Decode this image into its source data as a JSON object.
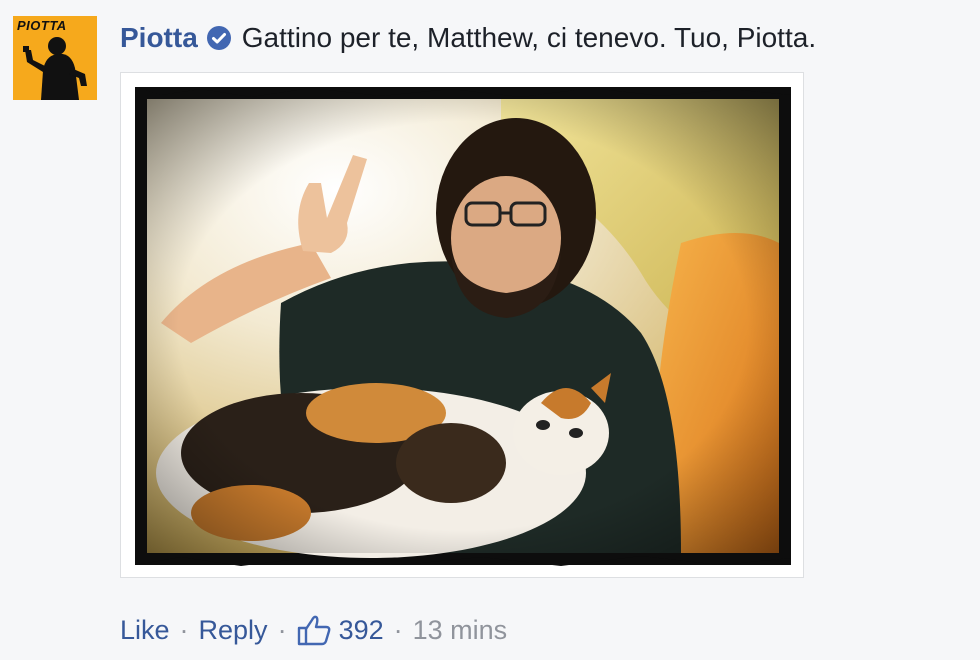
{
  "comment": {
    "author": "Piotta",
    "verified": true,
    "text": "Gattino per te, Matthew, ci tenevo. Tuo, Piotta.",
    "avatar": {
      "brand_text": "PIOTTA",
      "background": "#f6a91c"
    },
    "photo": {
      "caption": ""
    }
  },
  "actions": {
    "like_label": "Like",
    "separator": "·",
    "reply_label": "Reply",
    "like_count": "392",
    "timestamp": "13 mins"
  },
  "colors": {
    "link": "#365899",
    "text": "#1d2129",
    "meta": "#90949c",
    "verified_badge": "#4267b2",
    "background": "#f6f7f9"
  },
  "icons": {
    "verified": "verified-badge-icon",
    "like": "thumbs-up-icon"
  }
}
